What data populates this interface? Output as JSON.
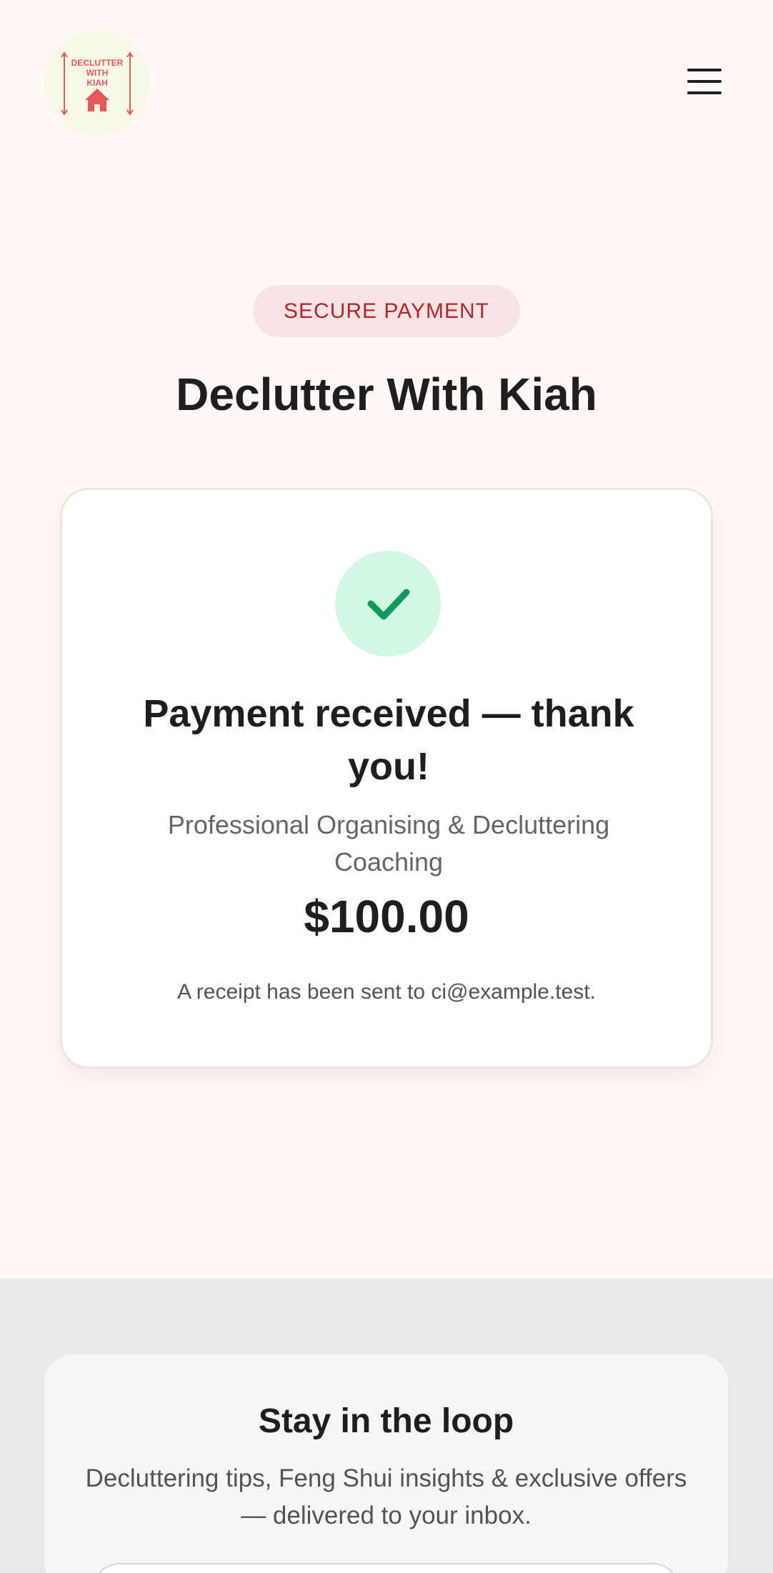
{
  "header": {
    "logo_text": [
      "DECLUTTER",
      "WITH",
      "KIAH"
    ],
    "menu_icon": "hamburger-menu-icon"
  },
  "badge": {
    "label": "SECURE PAYMENT"
  },
  "page": {
    "title": "Declutter With Kiah"
  },
  "card": {
    "icon": "checkmark-icon",
    "heading": "Payment received — thank you!",
    "service": "Professional Organising & Decluttering Coaching",
    "amount": "$100.00",
    "receipt": "A receipt has been sent to ci@example.test."
  },
  "newsletter": {
    "title": "Stay in the loop",
    "text": "Decluttering tips, Feng Shui insights & exclusive offers — delivered to your inbox."
  },
  "colors": {
    "background": "#fff8f7",
    "badge_bg": "#f7e3e3",
    "badge_text": "#b3262b",
    "logo_bg": "#f7f8e6",
    "logo_red": "#e8585b",
    "check_bg": "#d2f7e3",
    "check_green": "#0f9a5c",
    "footer_bg": "#e9e9eb"
  }
}
